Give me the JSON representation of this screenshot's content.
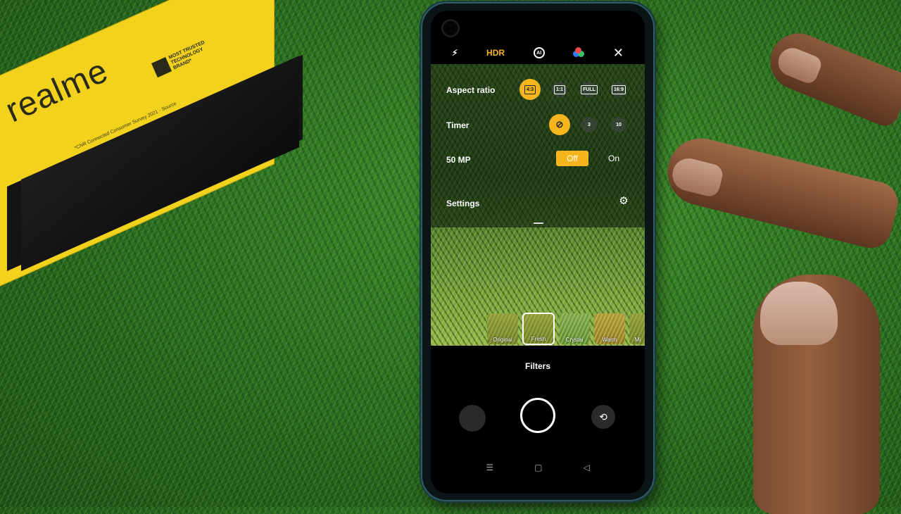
{
  "box": {
    "brand": "realme",
    "badge_text": "MOST TRUSTED TECHNOLOGY BRAND*",
    "survey_text": "*CNR Connected Consumer Survey 2021 - Source"
  },
  "camera": {
    "top_bar": {
      "flash_icon": "flash-auto-icon",
      "flash_label": "⚡︎",
      "hdr_label": "HDR",
      "ai_label": "AI",
      "color_icon": "color-mode-icon",
      "close_label": "✕"
    },
    "settings": {
      "aspect_ratio": {
        "label": "Aspect ratio",
        "options": [
          "4:3",
          "1:1",
          "FULL",
          "16:9"
        ],
        "selected": "4:3"
      },
      "timer": {
        "label": "Timer",
        "options": [
          "⊘",
          "3",
          "10"
        ],
        "selected": "off"
      },
      "mp": {
        "label": "50 MP",
        "off_label": "Off",
        "on_label": "On",
        "selected": "Off"
      },
      "settings_label": "Settings"
    },
    "filters": {
      "title": "Filters",
      "items": [
        "Original",
        "Fresh",
        "Crystal",
        "Warm",
        "Mi"
      ],
      "selected": "Fresh"
    },
    "nav": {
      "recent": "☰",
      "home": "▢",
      "back": "◁"
    }
  },
  "colors": {
    "accent": "#f6b51c",
    "box_yellow": "#f2d21c"
  }
}
